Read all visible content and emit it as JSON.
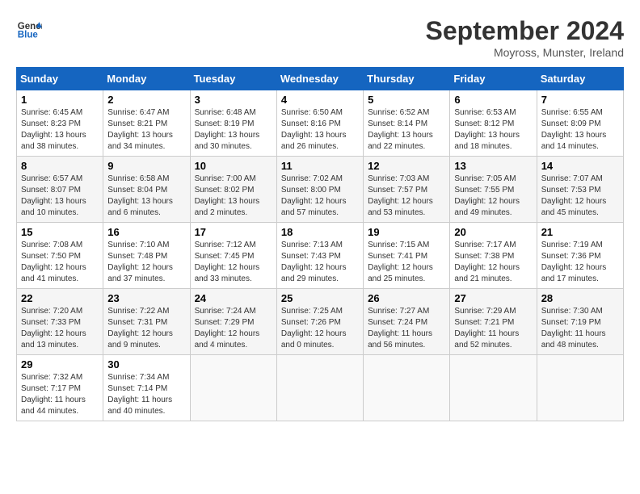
{
  "header": {
    "logo_line1": "General",
    "logo_line2": "Blue",
    "month": "September 2024",
    "location": "Moyross, Munster, Ireland"
  },
  "weekdays": [
    "Sunday",
    "Monday",
    "Tuesday",
    "Wednesday",
    "Thursday",
    "Friday",
    "Saturday"
  ],
  "weeks": [
    [
      {
        "day": "1",
        "sunrise": "6:45 AM",
        "sunset": "8:23 PM",
        "daylight": "13 hours and 38 minutes."
      },
      {
        "day": "2",
        "sunrise": "6:47 AM",
        "sunset": "8:21 PM",
        "daylight": "13 hours and 34 minutes."
      },
      {
        "day": "3",
        "sunrise": "6:48 AM",
        "sunset": "8:19 PM",
        "daylight": "13 hours and 30 minutes."
      },
      {
        "day": "4",
        "sunrise": "6:50 AM",
        "sunset": "8:16 PM",
        "daylight": "13 hours and 26 minutes."
      },
      {
        "day": "5",
        "sunrise": "6:52 AM",
        "sunset": "8:14 PM",
        "daylight": "13 hours and 22 minutes."
      },
      {
        "day": "6",
        "sunrise": "6:53 AM",
        "sunset": "8:12 PM",
        "daylight": "13 hours and 18 minutes."
      },
      {
        "day": "7",
        "sunrise": "6:55 AM",
        "sunset": "8:09 PM",
        "daylight": "13 hours and 14 minutes."
      }
    ],
    [
      {
        "day": "8",
        "sunrise": "6:57 AM",
        "sunset": "8:07 PM",
        "daylight": "13 hours and 10 minutes."
      },
      {
        "day": "9",
        "sunrise": "6:58 AM",
        "sunset": "8:04 PM",
        "daylight": "13 hours and 6 minutes."
      },
      {
        "day": "10",
        "sunrise": "7:00 AM",
        "sunset": "8:02 PM",
        "daylight": "13 hours and 2 minutes."
      },
      {
        "day": "11",
        "sunrise": "7:02 AM",
        "sunset": "8:00 PM",
        "daylight": "12 hours and 57 minutes."
      },
      {
        "day": "12",
        "sunrise": "7:03 AM",
        "sunset": "7:57 PM",
        "daylight": "12 hours and 53 minutes."
      },
      {
        "day": "13",
        "sunrise": "7:05 AM",
        "sunset": "7:55 PM",
        "daylight": "12 hours and 49 minutes."
      },
      {
        "day": "14",
        "sunrise": "7:07 AM",
        "sunset": "7:53 PM",
        "daylight": "12 hours and 45 minutes."
      }
    ],
    [
      {
        "day": "15",
        "sunrise": "7:08 AM",
        "sunset": "7:50 PM",
        "daylight": "12 hours and 41 minutes."
      },
      {
        "day": "16",
        "sunrise": "7:10 AM",
        "sunset": "7:48 PM",
        "daylight": "12 hours and 37 minutes."
      },
      {
        "day": "17",
        "sunrise": "7:12 AM",
        "sunset": "7:45 PM",
        "daylight": "12 hours and 33 minutes."
      },
      {
        "day": "18",
        "sunrise": "7:13 AM",
        "sunset": "7:43 PM",
        "daylight": "12 hours and 29 minutes."
      },
      {
        "day": "19",
        "sunrise": "7:15 AM",
        "sunset": "7:41 PM",
        "daylight": "12 hours and 25 minutes."
      },
      {
        "day": "20",
        "sunrise": "7:17 AM",
        "sunset": "7:38 PM",
        "daylight": "12 hours and 21 minutes."
      },
      {
        "day": "21",
        "sunrise": "7:19 AM",
        "sunset": "7:36 PM",
        "daylight": "12 hours and 17 minutes."
      }
    ],
    [
      {
        "day": "22",
        "sunrise": "7:20 AM",
        "sunset": "7:33 PM",
        "daylight": "12 hours and 13 minutes."
      },
      {
        "day": "23",
        "sunrise": "7:22 AM",
        "sunset": "7:31 PM",
        "daylight": "12 hours and 9 minutes."
      },
      {
        "day": "24",
        "sunrise": "7:24 AM",
        "sunset": "7:29 PM",
        "daylight": "12 hours and 4 minutes."
      },
      {
        "day": "25",
        "sunrise": "7:25 AM",
        "sunset": "7:26 PM",
        "daylight": "12 hours and 0 minutes."
      },
      {
        "day": "26",
        "sunrise": "7:27 AM",
        "sunset": "7:24 PM",
        "daylight": "11 hours and 56 minutes."
      },
      {
        "day": "27",
        "sunrise": "7:29 AM",
        "sunset": "7:21 PM",
        "daylight": "11 hours and 52 minutes."
      },
      {
        "day": "28",
        "sunrise": "7:30 AM",
        "sunset": "7:19 PM",
        "daylight": "11 hours and 48 minutes."
      }
    ],
    [
      {
        "day": "29",
        "sunrise": "7:32 AM",
        "sunset": "7:17 PM",
        "daylight": "11 hours and 44 minutes."
      },
      {
        "day": "30",
        "sunrise": "7:34 AM",
        "sunset": "7:14 PM",
        "daylight": "11 hours and 40 minutes."
      },
      null,
      null,
      null,
      null,
      null
    ]
  ],
  "labels": {
    "sunrise": "Sunrise:",
    "sunset": "Sunset:",
    "daylight": "Daylight:"
  }
}
